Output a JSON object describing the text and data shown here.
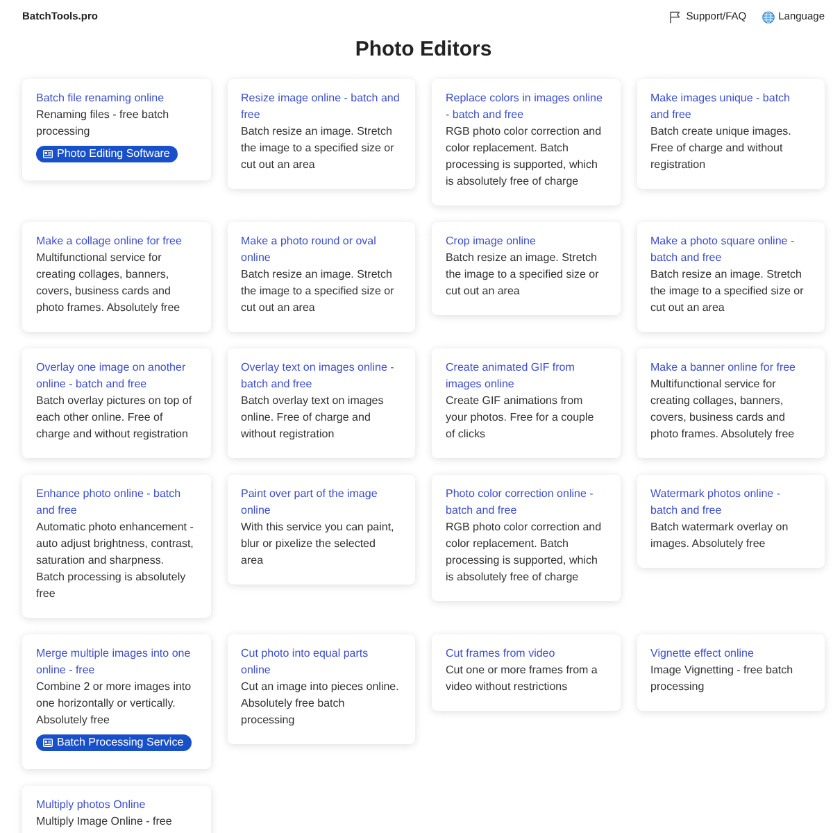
{
  "header": {
    "logo": "BatchTools.pro",
    "links": [
      {
        "kind": "support",
        "label": "Support/FAQ"
      },
      {
        "kind": "language",
        "label": "Language"
      }
    ]
  },
  "page_title": "Photo Editors",
  "cards": [
    {
      "title": "Batch file renaming online",
      "description": "Renaming files - free batch processing",
      "badge": "Photo Editing Software"
    },
    {
      "title": "Resize image online - batch and free",
      "description": "Batch resize an image. Stretch the image to a specified size or cut out an area"
    },
    {
      "title": "Replace colors in images online - batch and free",
      "description": "RGB photo color correction and color replacement. Batch processing is supported, which is absolutely free of charge"
    },
    {
      "title": "Make images unique - batch and free",
      "description": "Batch create unique images. Free of charge and without registration"
    },
    {
      "title": "Make a collage online for free",
      "description": "Multifunctional service for creating collages, banners, covers, business cards and photo frames. Absolutely free"
    },
    {
      "title": "Make a photo round or oval online",
      "description": "Batch resize an image. Stretch the image to a specified size or cut out an area"
    },
    {
      "title": "Crop image online",
      "description": "Batch resize an image. Stretch the image to a specified size or cut out an area"
    },
    {
      "title": "Make a photo square online - batch and free",
      "description": "Batch resize an image. Stretch the image to a specified size or cut out an area"
    },
    {
      "title": "Overlay one image on another online - batch and free",
      "description": "Batch overlay pictures on top of each other online. Free of charge and without registration"
    },
    {
      "title": "Overlay text on images online - batch and free",
      "description": "Batch overlay text on images online. Free of charge and without registration"
    },
    {
      "title": "Create animated GIF from images online",
      "description": "Create GIF animations from your photos. Free for a couple of clicks"
    },
    {
      "title": "Make a banner online for free",
      "description": "Multifunctional service for creating collages, banners, covers, business cards and photo frames. Absolutely free"
    },
    {
      "title": "Enhance photo online - batch and free",
      "description": "Automatic photo enhancement - auto adjust brightness, contrast, saturation and sharpness. Batch processing is absolutely free"
    },
    {
      "title": "Paint over part of the image online",
      "description": "With this service you can paint, blur or pixelize the selected area"
    },
    {
      "title": "Photo color correction online - batch and free",
      "description": "RGB photo color correction and color replacement. Batch processing is supported, which is absolutely free of charge"
    },
    {
      "title": "Watermark photos online - batch and free",
      "description": "Batch watermark overlay on images. Absolutely free"
    },
    {
      "title": "Merge multiple images into one online - free",
      "description": "Combine 2 or more images into one horizontally or vertically. Absolutely free",
      "badge": "Batch Processing Service"
    },
    {
      "title": "Cut photo into equal parts online",
      "description": "Cut an image into pieces online. Absolutely free batch processing"
    },
    {
      "title": "Cut frames from video",
      "description": "Cut one or more frames from a video without restrictions"
    },
    {
      "title": "Vignette effect online",
      "description": "Image Vignetting - free batch processing"
    },
    {
      "title": "Multiply photos Online",
      "description": "Multiply Image Online - free"
    }
  ]
}
